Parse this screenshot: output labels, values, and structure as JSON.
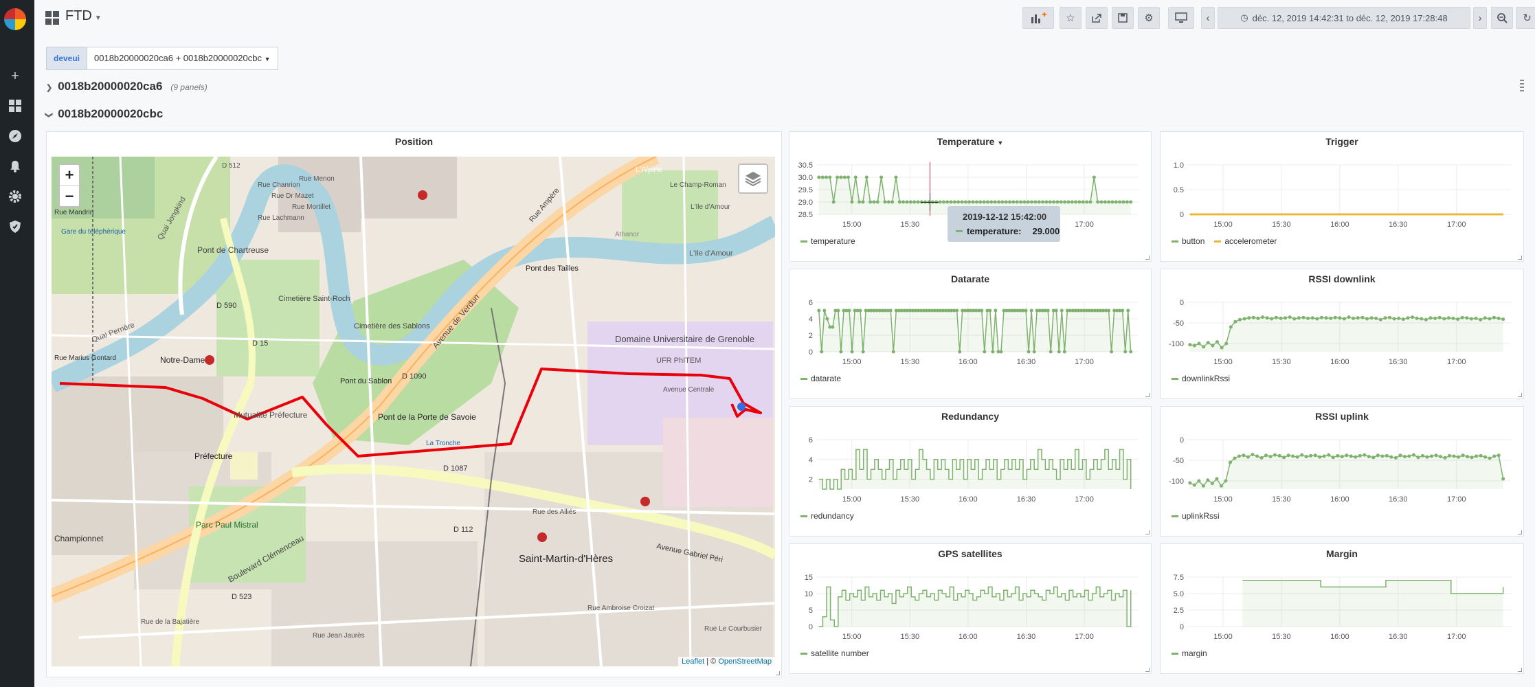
{
  "topnav": {
    "title": "FTD",
    "time_range": "déc. 12, 2019 14:42:31 to déc. 12, 2019 17:28:48"
  },
  "variables": {
    "label": "deveui",
    "value": "0018b20000020ca6 + 0018b20000020cbc"
  },
  "rows": [
    {
      "title": "0018b20000020ca6",
      "subtitle": "(9 panels)",
      "collapsed": true
    },
    {
      "title": "0018b20000020cbc",
      "collapsed": false
    }
  ],
  "map_panel": {
    "title": "Position",
    "labels": [
      "D 512",
      "Pont de Chartreuse",
      "Quai Jongkind",
      "Rue Lachmann",
      "Rue Chanrion",
      "Rue Dr Mazet",
      "Rue Menon",
      "Rue Mortillet",
      "Cimetière Saint-Roch",
      "Cimetière des Sablons",
      "Pont du Sablon",
      "Avenue de Verdun",
      "Pont des Tailles",
      "Rue Ampère",
      "Pont de la Porte de Savoie",
      "Notre-Dame",
      "Mutualité Préfecture",
      "Préfecture",
      "Parc Paul Mistral",
      "Boulevard Clémenceau",
      "D 1090",
      "D 1087",
      "D 112",
      "D 523",
      "D 590",
      "D 15",
      "Quai Perrière",
      "Gare du téléphérique",
      "Saint-Martin-d'Hères",
      "Domaine Universitaire de Grenoble",
      "L'Alpine",
      "L'Ile d'Amour",
      "Avenue Gabriel Péri",
      "Championnet",
      "Rue Marius Gontard",
      "UFR PhITEM",
      "Avenue Centrale",
      "Athanor",
      "La Tronche",
      "Rue Mandrin",
      "Le Champ-Roman",
      "L'Ile d'Amour",
      "Rue des Alliés",
      "Rue Ambroise Croizat",
      "Rue Le Courbusier",
      "Rue Jean Jaurès",
      "Rue de la Bajatière"
    ],
    "attribution_leaflet": "Leaflet",
    "attribution_sep": "| ©",
    "attribution_osm": "OpenStreetMap"
  },
  "tooltip": {
    "time": "2019-12-12 15:42:00",
    "series": "temperature:",
    "value": "29.000"
  },
  "panels": {
    "temperature": {
      "title": "Temperature"
    },
    "trigger": {
      "title": "Trigger"
    },
    "datarate": {
      "title": "Datarate"
    },
    "rssi_down": {
      "title": "RSSI downlink"
    },
    "redundancy": {
      "title": "Redundancy"
    },
    "rssi_up": {
      "title": "RSSI uplink"
    },
    "gps": {
      "title": "GPS satellites"
    },
    "margin": {
      "title": "Margin"
    }
  },
  "colors": {
    "green": "#7eb26d",
    "yellow": "#eab839",
    "route": "#e8000b"
  },
  "chart_data": [
    {
      "id": "temperature",
      "type": "line",
      "title": "Temperature",
      "ylim": [
        28.5,
        30.5
      ],
      "yticks": [
        28.5,
        29.0,
        29.5,
        30.0,
        30.5
      ],
      "ytick_labels": [
        "28.5",
        "29.0",
        "29.5",
        "30.0",
        "30.5"
      ],
      "xticks": [
        "15:00",
        "15:30",
        "16:00",
        "16:30",
        "17:00"
      ],
      "series": [
        {
          "name": "temperature",
          "color": "#7eb26d",
          "values": [
            30,
            30,
            30,
            30,
            29,
            30,
            30,
            30,
            30,
            29,
            30,
            29,
            29,
            30,
            29,
            29,
            29,
            30,
            29,
            29,
            29,
            30,
            29,
            29,
            29,
            29,
            29,
            29,
            29,
            29,
            29,
            29,
            29,
            29,
            29,
            29,
            29,
            29,
            29,
            29,
            29,
            29,
            29,
            29,
            29,
            29,
            29,
            29,
            29,
            29,
            29,
            29,
            29,
            29,
            29,
            29,
            29,
            29,
            29,
            29,
            29,
            29,
            29,
            29,
            29,
            29,
            29,
            29,
            29,
            29,
            29,
            29,
            29,
            29,
            29,
            30,
            29,
            29,
            29,
            29,
            29,
            29,
            29,
            29,
            29,
            29
          ]
        }
      ]
    },
    {
      "id": "trigger",
      "type": "line",
      "title": "Trigger",
      "ylim": [
        0,
        1
      ],
      "yticks": [
        0,
        0.5,
        1.0
      ],
      "ytick_labels": [
        "0",
        "0.5",
        "1.0"
      ],
      "xticks": [
        "15:00",
        "15:30",
        "16:00",
        "16:30",
        "17:00"
      ],
      "series": [
        {
          "name": "button",
          "color": "#7eb26d",
          "values": [
            0,
            0
          ]
        },
        {
          "name": "accelerometer",
          "color": "#eab839",
          "values": [
            0,
            0
          ]
        }
      ]
    },
    {
      "id": "datarate",
      "type": "line",
      "title": "Datarate",
      "ylim": [
        0,
        6
      ],
      "yticks": [
        0,
        2,
        4,
        6
      ],
      "ytick_labels": [
        "0",
        "2",
        "4",
        "6"
      ],
      "xticks": [
        "15:00",
        "15:30",
        "16:00",
        "16:30",
        "17:00"
      ],
      "series": [
        {
          "name": "datarate",
          "color": "#7eb26d",
          "values": [
            5,
            0,
            5,
            4,
            3,
            3,
            5,
            5,
            0,
            5,
            5,
            5,
            0,
            5,
            5,
            5,
            0,
            5,
            5,
            5,
            5,
            5,
            5,
            5,
            5,
            5,
            5,
            0,
            5,
            5,
            5,
            5,
            5,
            5,
            5,
            5,
            5,
            5,
            5,
            5,
            5,
            5,
            5,
            5,
            5,
            5,
            5,
            5,
            5,
            5,
            5,
            0,
            5,
            5,
            5,
            5,
            5,
            5,
            5,
            5,
            0,
            5,
            5,
            0,
            5,
            0,
            0,
            5,
            5,
            5,
            5,
            5,
            5,
            5,
            5,
            5,
            0,
            5,
            0,
            5,
            5,
            5,
            5,
            5,
            0,
            5,
            5,
            0,
            5,
            0,
            5,
            5,
            5,
            5,
            5,
            5,
            5,
            5,
            5,
            5,
            5,
            5,
            5,
            5,
            5,
            5,
            0,
            5,
            5,
            5,
            5,
            0,
            5,
            0
          ]
        }
      ]
    },
    {
      "id": "rssi_downlink",
      "type": "line",
      "title": "RSSI downlink",
      "ylim": [
        -120,
        0
      ],
      "yticks": [
        -100,
        -50,
        0
      ],
      "ytick_labels": [
        "-100",
        "-50",
        "0"
      ],
      "xticks": [
        "15:00",
        "15:30",
        "16:00",
        "16:30",
        "17:00"
      ],
      "series": [
        {
          "name": "downlinkRssi",
          "color": "#7eb26d",
          "values": [
            -103,
            -105,
            -100,
            -108,
            -98,
            -105,
            -96,
            -110,
            -100,
            -60,
            -47,
            -42,
            -40,
            -38,
            -37,
            -39,
            -36,
            -38,
            -40,
            -37,
            -39,
            -38,
            -36,
            -40,
            -38,
            -37,
            -39,
            -38,
            -40,
            -37,
            -38,
            -39,
            -37,
            -38,
            -40,
            -36,
            -39,
            -38,
            -37,
            -40,
            -38,
            -39,
            -42,
            -38,
            -37,
            -40,
            -39,
            -41,
            -38,
            -36,
            -39,
            -40,
            -42,
            -38,
            -39,
            -37,
            -40,
            -38,
            -39,
            -41,
            -37,
            -38,
            -40,
            -39,
            -42,
            -38,
            -40,
            -37,
            -39,
            -41
          ]
        }
      ]
    },
    {
      "id": "redundancy",
      "type": "line",
      "title": "Redundancy",
      "ylim": [
        1,
        6
      ],
      "yticks": [
        2,
        4,
        6
      ],
      "ytick_labels": [
        "2",
        "4",
        "6"
      ],
      "xticks": [
        "15:00",
        "15:30",
        "16:00",
        "16:30",
        "17:00"
      ],
      "series": [
        {
          "name": "redundancy",
          "color": "#7eb26d",
          "values": [
            2,
            1,
            2,
            1,
            2,
            1,
            3,
            2,
            3,
            2,
            5,
            3,
            5,
            2,
            3,
            4,
            3,
            2,
            3,
            4,
            2,
            3,
            4,
            3,
            4,
            2,
            3,
            5,
            4,
            3,
            2,
            4,
            3,
            4,
            3,
            2,
            4,
            3,
            4,
            2,
            4,
            3,
            4,
            2,
            3,
            4,
            3,
            4,
            2,
            3,
            4,
            3,
            4,
            3,
            4,
            2,
            3,
            4,
            3,
            5,
            4,
            3,
            4,
            3,
            2,
            4,
            3,
            4,
            3,
            5,
            3,
            4,
            2,
            3,
            4,
            3,
            4,
            5,
            3,
            4,
            3,
            5,
            2,
            4,
            1
          ]
        }
      ]
    },
    {
      "id": "rssi_uplink",
      "type": "line",
      "title": "RSSI uplink",
      "ylim": [
        -120,
        0
      ],
      "yticks": [
        -100,
        -50,
        0
      ],
      "ytick_labels": [
        "-100",
        "-50",
        "0"
      ],
      "xticks": [
        "15:00",
        "15:30",
        "16:00",
        "16:30",
        "17:00"
      ],
      "series": [
        {
          "name": "uplinkRssi",
          "color": "#7eb26d",
          "values": [
            -105,
            -110,
            -100,
            -112,
            -98,
            -106,
            -95,
            -112,
            -100,
            -55,
            -45,
            -40,
            -38,
            -42,
            -36,
            -40,
            -44,
            -38,
            -41,
            -37,
            -39,
            -43,
            -38,
            -40,
            -42,
            -37,
            -41,
            -39,
            -38,
            -42,
            -40,
            -37,
            -43,
            -39,
            -41,
            -38,
            -40,
            -42,
            -39,
            -37,
            -41,
            -43,
            -38,
            -40,
            -39,
            -42,
            -44,
            -38,
            -41,
            -40,
            -37,
            -43,
            -39,
            -42,
            -40,
            -38,
            -41,
            -44,
            -39,
            -40,
            -42,
            -38,
            -41,
            -43,
            -40,
            -39,
            -42,
            -45,
            -40,
            -38,
            -95
          ]
        }
      ]
    },
    {
      "id": "gps_satellites",
      "type": "line",
      "title": "GPS satellites",
      "ylim": [
        0,
        15
      ],
      "yticks": [
        0,
        5,
        10,
        15
      ],
      "ytick_labels": [
        "0",
        "5",
        "10",
        "15"
      ],
      "xticks": [
        "15:00",
        "15:30",
        "16:00",
        "16:30",
        "17:00"
      ],
      "series": [
        {
          "name": "satellite number",
          "color": "#7eb26d",
          "values": [
            0,
            3,
            12,
            2,
            0,
            9,
            11,
            8,
            10,
            9,
            11,
            8,
            12,
            9,
            10,
            8,
            11,
            9,
            10,
            7,
            11,
            9,
            10,
            12,
            9,
            8,
            10,
            11,
            9,
            10,
            8,
            11,
            10,
            9,
            12,
            8,
            10,
            9,
            11,
            10,
            8,
            9,
            11,
            10,
            12,
            9,
            10,
            8,
            11,
            9,
            10,
            12,
            8,
            10,
            9,
            11,
            10,
            9,
            8,
            11,
            10,
            12,
            9,
            10,
            8,
            11,
            9,
            10,
            9,
            11,
            8,
            10,
            12,
            9,
            10,
            11,
            8,
            10,
            9,
            11,
            0,
            11
          ]
        }
      ]
    },
    {
      "id": "margin",
      "type": "line",
      "title": "Margin",
      "ylim": [
        0,
        7.5
      ],
      "yticks": [
        0,
        2.5,
        5.0,
        7.5
      ],
      "ytick_labels": [
        "0",
        "2.5",
        "5.0",
        "7.5"
      ],
      "xticks": [
        "15:00",
        "15:30",
        "16:00",
        "16:30",
        "17:00"
      ],
      "series": [
        {
          "name": "margin",
          "color": "#7eb26d",
          "values": [
            7,
            7,
            7,
            7,
            7,
            7,
            6,
            6,
            6,
            6,
            6,
            7,
            7,
            7,
            7,
            7,
            5,
            5,
            5,
            5,
            6
          ]
        }
      ]
    }
  ]
}
